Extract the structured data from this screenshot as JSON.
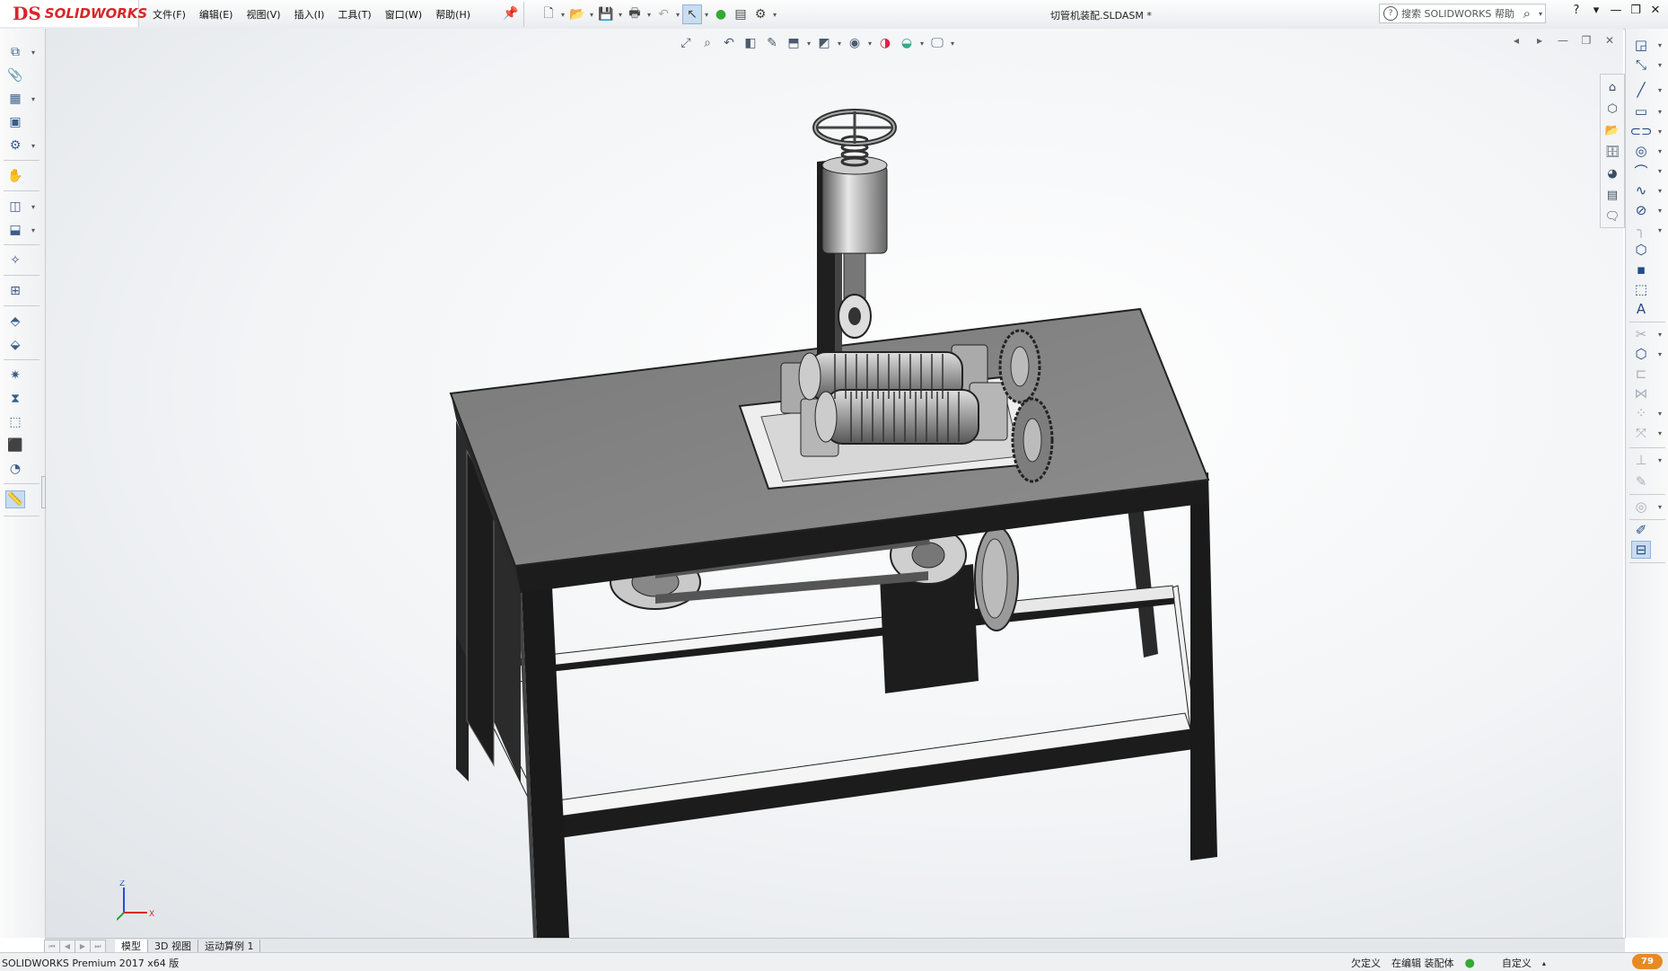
{
  "app": {
    "logo_ds": "DS",
    "logo_brand": "SOLIDWORKS"
  },
  "menu": [
    "文件(F)",
    "编辑(E)",
    "视图(V)",
    "插入(I)",
    "工具(T)",
    "窗口(W)",
    "帮助(H)"
  ],
  "document_title": "切管机装配.SLDASM *",
  "help_search": {
    "placeholder": "搜索 SOLIDWORKS 帮助"
  },
  "bottom_tabs": [
    "模型",
    "3D 视图",
    "运动算例 1"
  ],
  "status": {
    "product": "SOLIDWORKS Premium 2017 x64 版",
    "underdefined": "欠定义",
    "editing": "在编辑 装配体",
    "units": "自定义",
    "badge": "79"
  },
  "colors": {
    "accent_red": "#d8262b",
    "selected_blue": "#c9dcf0",
    "status_badge": "#e88a22",
    "table_top": "#8a8a8a",
    "frame_black": "#1c1c1c"
  }
}
